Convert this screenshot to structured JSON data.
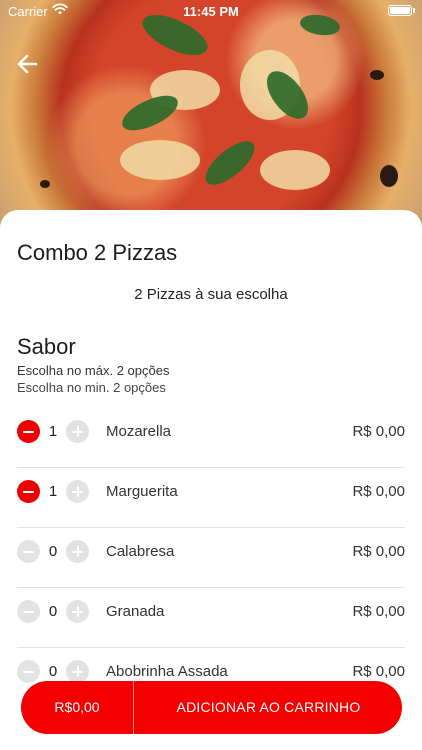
{
  "status_bar": {
    "carrier": "Carrier",
    "time": "11:45 PM"
  },
  "product": {
    "title": "Combo 2 Pizzas",
    "description": "2 Pizzas à sua escolha"
  },
  "section": {
    "title": "Sabor",
    "max_rule": "Escolha no máx. 2 opções",
    "min_rule": "Escolha no min. 2 opções"
  },
  "options": [
    {
      "name": "Mozarella",
      "qty": "1",
      "price": "R$ 0,00"
    },
    {
      "name": "Marguerita",
      "qty": "1",
      "price": "R$ 0,00"
    },
    {
      "name": "Calabresa",
      "qty": "0",
      "price": "R$ 0,00"
    },
    {
      "name": "Granada",
      "qty": "0",
      "price": "R$ 0,00"
    },
    {
      "name": "Abobrinha Assada",
      "qty": "0",
      "price": "R$ 0,00"
    }
  ],
  "cart_bar": {
    "total": "R$0,00",
    "add_label": "ADICIONAR AO CARRINHO"
  },
  "colors": {
    "accent": "#f50000",
    "minus_active": "#ee0000",
    "disabled": "#e3e3e3"
  },
  "icons": {
    "back": "arrow-left-icon",
    "minus": "minus-icon",
    "plus": "plus-icon",
    "wifi": "wifi-icon",
    "battery": "battery-icon"
  }
}
